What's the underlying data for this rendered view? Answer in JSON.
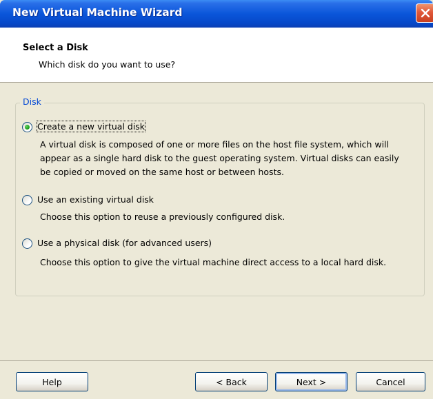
{
  "window": {
    "title": "New Virtual Machine Wizard"
  },
  "header": {
    "title": "Select a Disk",
    "subtitle": "Which disk do you want to use?"
  },
  "disk_group": {
    "label": "Disk",
    "options": [
      {
        "label": "Create a new virtual disk",
        "selected": true,
        "description": "A virtual disk is composed of one or more files on the host file system, which will appear as a single hard disk to the guest operating system. Virtual disks can easily be copied or moved on the same host or between hosts."
      },
      {
        "label": "Use an existing virtual disk",
        "selected": false,
        "description": "Choose this option to reuse a previously configured disk."
      },
      {
        "label": "Use a physical disk (for advanced users)",
        "selected": false,
        "description": "Choose this option to give the virtual machine direct access to a local hard disk."
      }
    ]
  },
  "buttons": {
    "help": "Help",
    "back": "< Back",
    "next": "Next >",
    "cancel": "Cancel"
  },
  "icons": {
    "close": "close-icon"
  },
  "colors": {
    "title_bar": "#0A56DA",
    "close": "#E0583A",
    "group_label": "#0046D5",
    "radio_dot": "#21A121"
  }
}
